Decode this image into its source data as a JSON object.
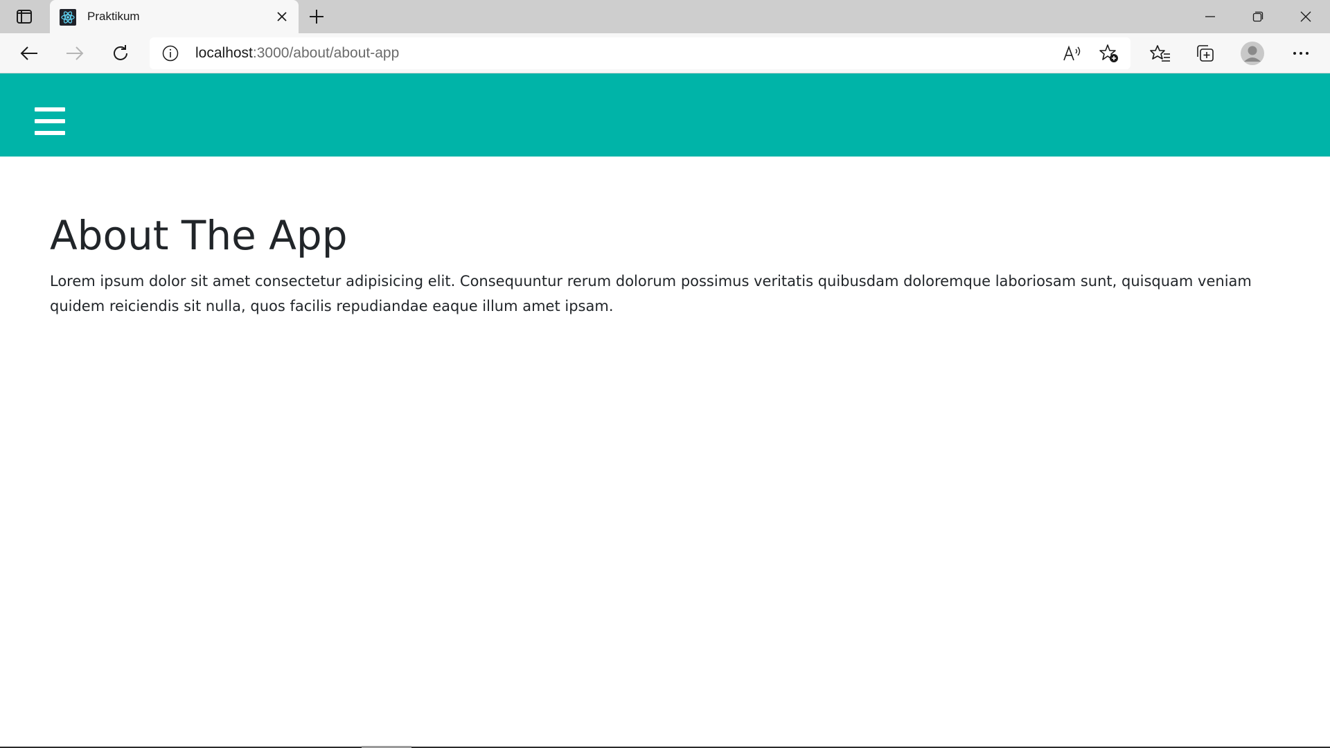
{
  "browser": {
    "tab": {
      "title": "Praktikum",
      "favicon": "react-icon"
    },
    "address": {
      "host": "localhost",
      "path": ":3000/about/about-app"
    },
    "icons": {
      "tab_actions": "tab-actions-icon",
      "new_tab": "plus-icon",
      "back": "back-arrow-icon",
      "forward": "forward-arrow-icon",
      "refresh": "refresh-icon",
      "site_info": "info-icon",
      "read_aloud": "read-aloud-icon",
      "add_favorite": "add-favorite-star-icon",
      "favorites": "favorites-icon",
      "collections": "collections-icon",
      "profile": "profile-avatar-icon",
      "more": "more-dots-icon",
      "minimize": "minimize-icon",
      "restore": "restore-icon",
      "close": "close-icon"
    }
  },
  "app": {
    "header_color": "#00b4a8",
    "menu_icon": "hamburger-menu-icon",
    "title": "About The App",
    "body": "Lorem ipsum dolor sit amet consectetur adipisicing elit. Consequuntur rerum dolorum possimus veritatis quibusdam doloremque laboriosam sunt, quisquam veniam quidem reiciendis sit nulla, quos facilis repudiandae eaque illum amet ipsam."
  }
}
